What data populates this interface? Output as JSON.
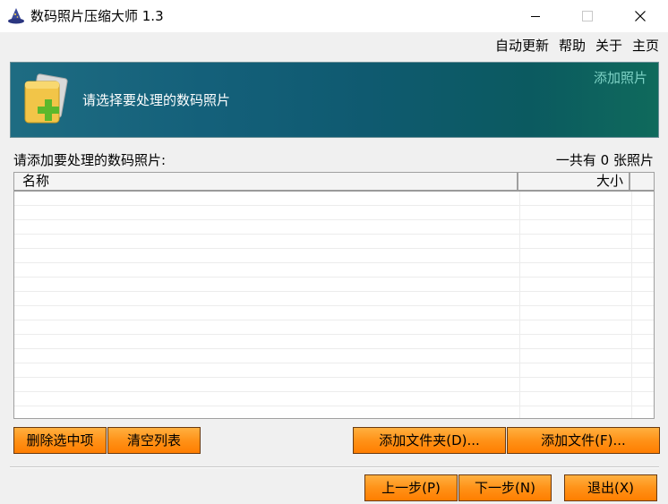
{
  "window": {
    "title": "数码照片压缩大师 1.3",
    "controls": [
      "minimize",
      "maximize",
      "close"
    ]
  },
  "menu": {
    "items": [
      "自动更新",
      "帮助",
      "关于",
      "主页"
    ]
  },
  "banner": {
    "instruction": "请选择要处理的数码照片",
    "add_link": "添加照片",
    "icon": "add-photo-folder-icon"
  },
  "list": {
    "caption": "请添加要处理的数码照片:",
    "count_text": "一共有 0 张照片",
    "columns": [
      "名称",
      "大小"
    ],
    "rows": []
  },
  "buttons": {
    "delete_selected": "删除选中项",
    "clear_list": "清空列表",
    "add_folder": "添加文件夹(D)...",
    "add_file": "添加文件(F)...",
    "prev": "上一步(P)",
    "next": "下一步(N)",
    "exit": "退出(X)"
  },
  "colors": {
    "banner_start": "#1e6c82",
    "banner_end": "#0f6a5c",
    "banner_link": "#7ed3c6",
    "button_orange": "#ff9218"
  }
}
